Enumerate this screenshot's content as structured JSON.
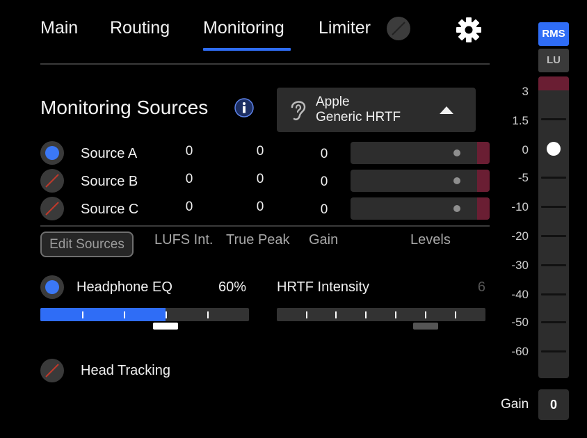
{
  "tabs": [
    {
      "label": "Main",
      "active": false
    },
    {
      "label": "Routing",
      "active": false
    },
    {
      "label": "Monitoring",
      "active": true
    },
    {
      "label": "Limiter",
      "active": false
    }
  ],
  "monitoring": {
    "title": "Monitoring Sources",
    "hrtf": {
      "line1": "Apple",
      "line2": "Generic HRTF"
    },
    "sources": [
      {
        "name": "Source A",
        "enabled": true,
        "lufs": "0",
        "true_peak": "0",
        "gain": "0"
      },
      {
        "name": "Source B",
        "enabled": false,
        "lufs": "0",
        "true_peak": "0",
        "gain": "0"
      },
      {
        "name": "Source C",
        "enabled": false,
        "lufs": "0",
        "true_peak": "0",
        "gain": "0"
      }
    ],
    "edit_sources_label": "Edit Sources",
    "columns": {
      "lufs": "LUFS Int.",
      "true_peak": "True Peak",
      "gain": "Gain",
      "levels": "Levels"
    }
  },
  "headphone_eq": {
    "label": "Headphone EQ",
    "value": "60%",
    "fraction": 0.6,
    "enabled": true
  },
  "hrtf_intensity": {
    "label": "HRTF Intensity",
    "value": "6"
  },
  "head_tracking": {
    "label": "Head Tracking",
    "enabled": false
  },
  "meter": {
    "rms_label": "RMS",
    "lu_label": "LU",
    "scale": [
      "3",
      "1.5",
      "0",
      "-5",
      "-10",
      "-20",
      "-30",
      "-40",
      "-50",
      "-60"
    ],
    "gain_label": "Gain",
    "gain_value": "0"
  },
  "colors": {
    "accent": "#2f6df6",
    "clip": "#6a1e33",
    "slash": "#c0392b"
  },
  "icons": {
    "settings": "gear-icon",
    "info": "info-icon",
    "hrtf": "ear-icon",
    "dropdown": "chevron-up-icon",
    "disabled": "slash-icon"
  }
}
